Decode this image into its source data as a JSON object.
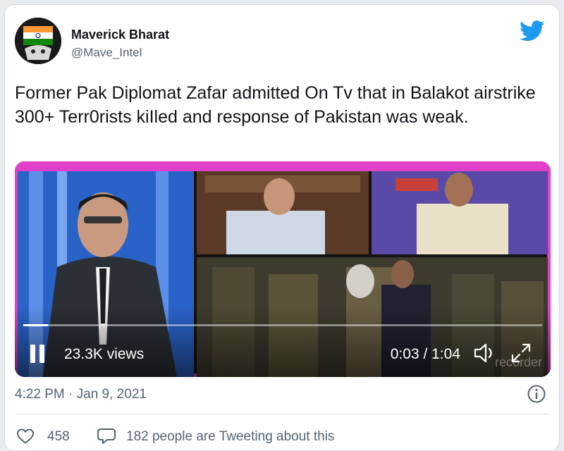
{
  "author": {
    "name": "Maverick Bharat",
    "handle": "@Mave_Intel"
  },
  "tweet": {
    "text": "Former Pak Diplomat Zafar admitted On Tv that in Balakot airstrike 300+ Terr0rists kiIled and response of Pakistan was weak."
  },
  "video": {
    "views": "23.3K views",
    "time": "0:03 / 1:04",
    "progress_fraction": 0.047,
    "watermark": "recorder"
  },
  "meta": {
    "timestamp": "4:22 PM · Jan 9, 2021"
  },
  "actions": {
    "like_count": "458",
    "reply_text": "182 people are Tweeting about this"
  },
  "icons": {
    "brand": "twitter-bird-icon",
    "info": "info-icon",
    "like": "heart-icon",
    "reply": "comment-bubble-icon",
    "pause": "pause-icon",
    "volume": "volume-icon",
    "fullscreen": "fullscreen-icon"
  },
  "colors": {
    "brand_blue": "#1d9bf0",
    "secondary_text": "#536471",
    "video_border": "#e040c8"
  }
}
